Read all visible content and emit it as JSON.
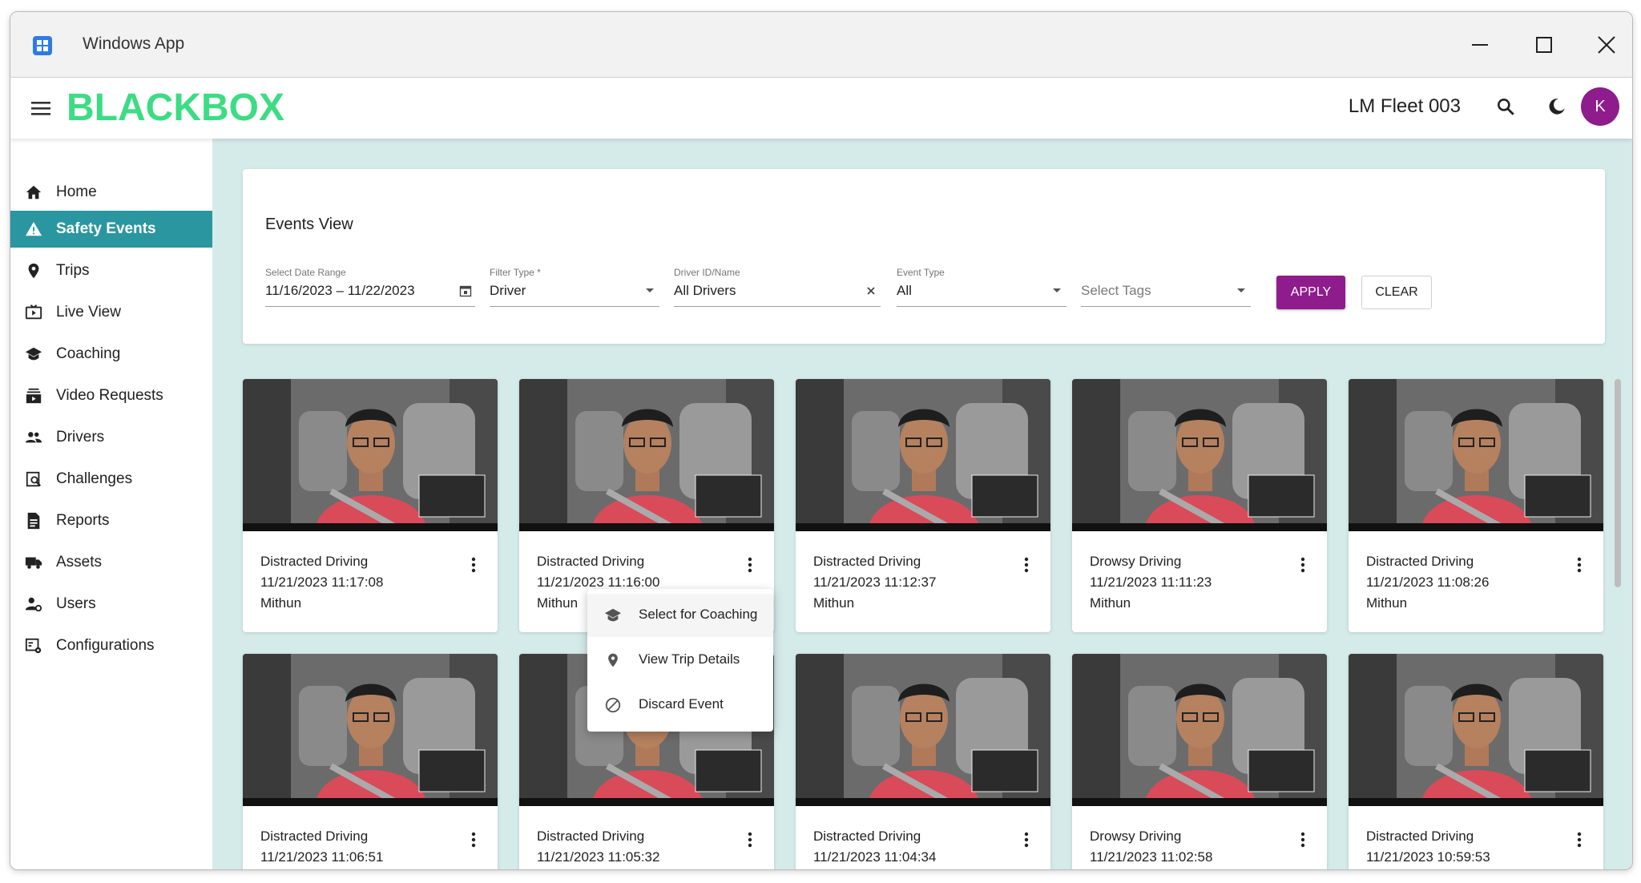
{
  "window": {
    "title": "Windows App"
  },
  "appbar": {
    "brand": "BLACKBOX",
    "fleet": "LM Fleet 003",
    "avatar_initial": "K"
  },
  "sidebar": {
    "items": [
      {
        "label": "Home",
        "icon": "home-icon"
      },
      {
        "label": "Safety Events",
        "icon": "warning-icon",
        "active": true
      },
      {
        "label": "Trips",
        "icon": "location-pin-icon"
      },
      {
        "label": "Live View",
        "icon": "live-tv-icon"
      },
      {
        "label": "Coaching",
        "icon": "graduation-cap-icon"
      },
      {
        "label": "Video Requests",
        "icon": "video-library-icon"
      },
      {
        "label": "Drivers",
        "icon": "people-icon"
      },
      {
        "label": "Challenges",
        "icon": "challenge-search-icon"
      },
      {
        "label": "Reports",
        "icon": "document-icon"
      },
      {
        "label": "Assets",
        "icon": "truck-icon"
      },
      {
        "label": "Users",
        "icon": "user-settings-icon"
      },
      {
        "label": "Configurations",
        "icon": "config-icon"
      }
    ]
  },
  "filters": {
    "title": "Events View",
    "date_range": {
      "label": "Select Date Range",
      "value": "11/16/2023 – 11/22/2023"
    },
    "filter_type": {
      "label": "Filter Type *",
      "value": "Driver"
    },
    "driver": {
      "label": "Driver ID/Name",
      "value": "All Drivers"
    },
    "event_type": {
      "label": "Event Type",
      "value": "All"
    },
    "tags": {
      "placeholder": "Select Tags"
    },
    "apply_label": "APPLY",
    "clear_label": "CLEAR"
  },
  "events": [
    {
      "type": "Distracted Driving",
      "time": "11/21/2023 11:17:08",
      "driver": "Mithun"
    },
    {
      "type": "Distracted Driving",
      "time": "11/21/2023 11:16:00",
      "driver": "Mithun"
    },
    {
      "type": "Distracted Driving",
      "time": "11/21/2023 11:12:37",
      "driver": "Mithun"
    },
    {
      "type": "Drowsy Driving",
      "time": "11/21/2023 11:11:23",
      "driver": "Mithun"
    },
    {
      "type": "Distracted Driving",
      "time": "11/21/2023 11:08:26",
      "driver": "Mithun"
    },
    {
      "type": "Distracted Driving",
      "time": "11/21/2023 11:06:51",
      "driver": ""
    },
    {
      "type": "Distracted Driving",
      "time": "11/21/2023 11:05:32",
      "driver": ""
    },
    {
      "type": "Distracted Driving",
      "time": "11/21/2023 11:04:34",
      "driver": ""
    },
    {
      "type": "Drowsy Driving",
      "time": "11/21/2023 11:02:58",
      "driver": ""
    },
    {
      "type": "Distracted Driving",
      "time": "11/21/2023 10:59:53",
      "driver": ""
    }
  ],
  "context_menu": {
    "items": [
      {
        "label": "Select for Coaching",
        "icon": "graduation-cap-icon"
      },
      {
        "label": "View Trip Details",
        "icon": "location-pin-icon"
      },
      {
        "label": "Discard Event",
        "icon": "block-icon"
      }
    ]
  },
  "colors": {
    "brand": "#3ddc84",
    "accent": "#8e1c8c",
    "nav_active": "#2a96a0",
    "main_bg": "#d5ebea"
  }
}
